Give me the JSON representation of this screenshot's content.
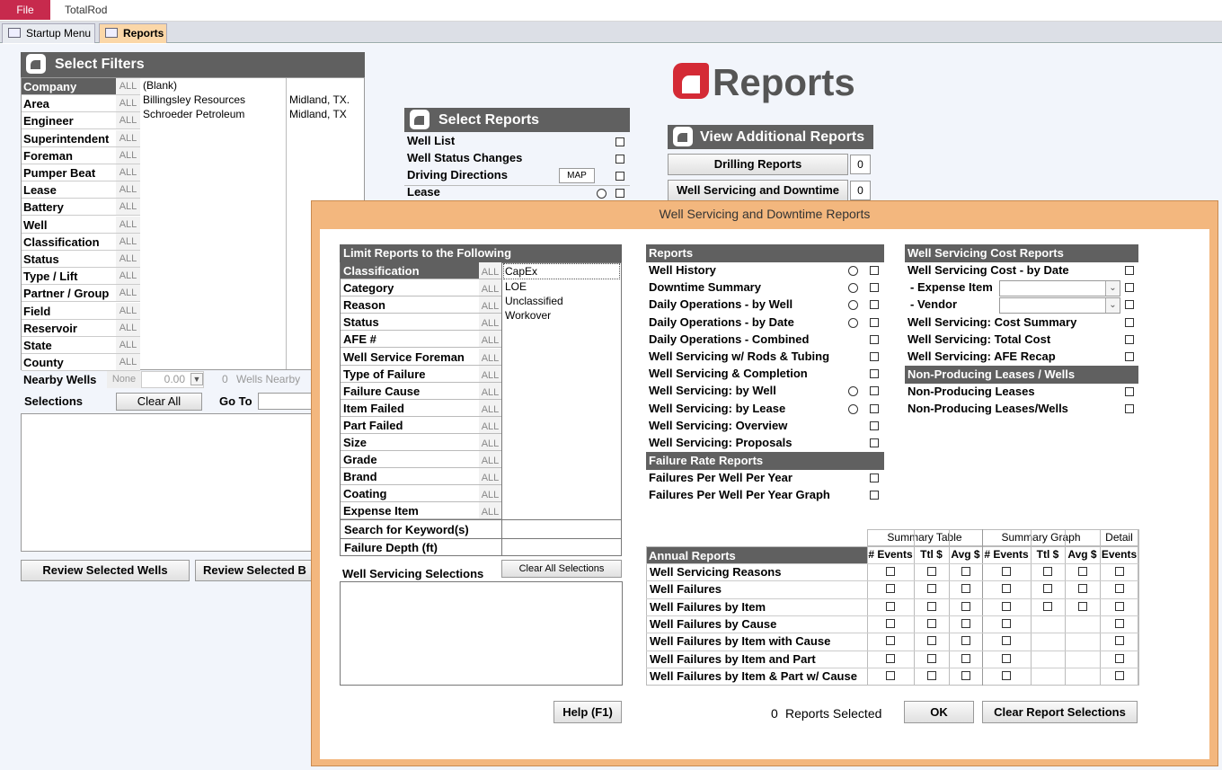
{
  "app": {
    "file_label": "File",
    "title": "TotalRod"
  },
  "tabs": [
    {
      "label": "Startup Menu"
    },
    {
      "label": "Reports"
    }
  ],
  "filters": {
    "title": "Select Filters",
    "all_label": "ALL",
    "labels": [
      "Company",
      "Area",
      "Engineer",
      "Superintendent",
      "Foreman",
      "Pumper Beat",
      "Lease",
      "Battery",
      "Well",
      "Classification",
      "Status",
      "Type / Lift",
      "Partner / Group",
      "Field",
      "Reservoir",
      "State",
      "County"
    ],
    "companies": [
      {
        "name": "(Blank)",
        "location": ""
      },
      {
        "name": "Billingsley Resources",
        "location": "Midland, TX."
      },
      {
        "name": "Schroeder Petroleum",
        "location": "Midland, TX"
      }
    ],
    "nearby": {
      "label": "Nearby Wells",
      "none": "None",
      "value": "0.00",
      "count": "0",
      "suffix": "Wells Nearby"
    },
    "selections_label": "Selections",
    "clear_all": "Clear All",
    "go_to": "Go To",
    "review_wells": "Review Selected Wells",
    "review_b": "Review Selected B"
  },
  "reports_logo": "Reports",
  "select_reports": {
    "title": "Select Reports",
    "items": [
      "Well List",
      "Well Status Changes",
      "Driving Directions",
      "Lease"
    ],
    "map_label": "MAP"
  },
  "additional": {
    "title": "View Additional Reports",
    "items": [
      {
        "label": "Drilling Reports",
        "count": "0"
      },
      {
        "label": "Well Servicing and Downtime",
        "count": "0"
      }
    ]
  },
  "dialog": {
    "title": "Well Servicing and Downtime Reports",
    "limit": {
      "title": "Limit Reports to the Following",
      "all_label": "ALL",
      "labels": [
        "Classification",
        "Category",
        "Reason",
        "Status",
        "AFE #",
        "Well Service Foreman",
        "Type of Failure",
        "Failure Cause",
        "Item Failed",
        "Part Failed",
        "Size",
        "Grade",
        "Brand",
        "Coating",
        "Expense Item"
      ],
      "classification_values": [
        "CapEx",
        "LOE",
        "Unclassified",
        "Workover"
      ],
      "keyword_label": "Search for Keyword(s)",
      "depth_label": "Failure Depth (ft)"
    },
    "ws_selections": "Well Servicing Selections",
    "clear_all_selections": "Clear All Selections",
    "help": "Help (F1)",
    "reports_header": "Reports",
    "reports": [
      "Well History",
      "Downtime Summary",
      "Daily Operations - by Well",
      "Daily Operations - by Date",
      "Daily Operations - Combined",
      "Well Servicing w/ Rods & Tubing",
      "Well Servicing & Completion",
      "Well Servicing: by Well",
      "Well Servicing: by Lease",
      "Well Servicing: Overview",
      "Well Servicing: Proposals"
    ],
    "failure_header": "Failure Rate Reports",
    "failure_reports": [
      "Failures Per Well Per Year",
      "Failures Per Well Per Year Graph"
    ],
    "cost_header": "Well Servicing Cost Reports",
    "cost_reports": [
      "Well Servicing Cost - by Date",
      "- Expense Item",
      "- Vendor",
      "Well Servicing: Cost Summary",
      "Well Servicing: Total Cost",
      "Well Servicing: AFE Recap"
    ],
    "nonprod_header": "Non-Producing Leases / Wells",
    "nonprod_reports": [
      "Non-Producing Leases",
      "Non-Producing Leases/Wells"
    ],
    "annual": {
      "header": "Annual Reports",
      "groups": [
        "Summary Table",
        "Summary Graph",
        "Detail"
      ],
      "cols": [
        "# Events",
        "Ttl $",
        "Avg $",
        "# Events",
        "Ttl $",
        "Avg $",
        "Events"
      ],
      "rows": [
        "Well Servicing Reasons",
        "Well Failures",
        "Well Failures by Item",
        "Well Failures by Cause",
        "Well Failures by Item with Cause",
        "Well Failures by Item and Part",
        "Well Failures by Item & Part w/ Cause"
      ]
    },
    "selected_count": "0",
    "selected_label": "Reports Selected",
    "ok": "OK",
    "clear_report": "Clear Report Selections"
  }
}
